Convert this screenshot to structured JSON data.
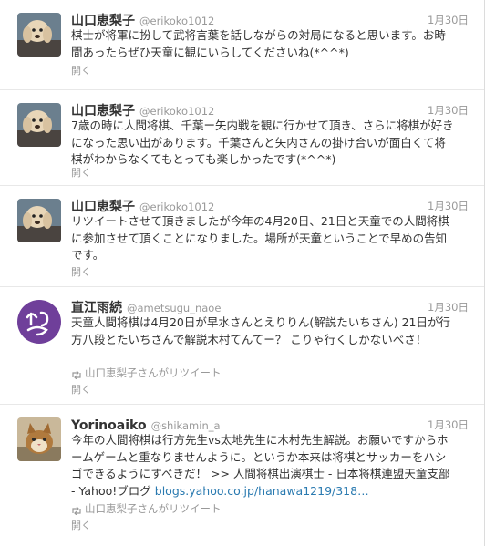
{
  "tweets": [
    {
      "name": "山口恵梨子",
      "handle": "@erikoko1012",
      "time": "1月30日",
      "text": "棋士が将軍に扮して武将言葉を話しながらの対局になると思います。お時間あったらぜひ天童に観にいらしてくださいね(*^^*)",
      "expand": "開く"
    },
    {
      "name": "山口恵梨子",
      "handle": "@erikoko1012",
      "time": "1月30日",
      "text": "7歳の時に人間将棋、千葉ー矢内戦を観に行かせて頂き、さらに将棋が好きになった思い出があります。千葉さんと矢内さんの掛け合いが面白くて将棋がわからなくてもとっても楽しかったです(*^^*)",
      "expand": "開く"
    },
    {
      "name": "山口恵梨子",
      "handle": "@erikoko1012",
      "time": "1月30日",
      "text": "リツイートさせて頂きましたが今年の4月20日、21日と天童での人間将棋に参加させて頂くことになりました。場所が天童ということで早めの告知です。",
      "expand": "開く"
    },
    {
      "name": "直江雨続",
      "handle": "@ametsugu_naoe",
      "time": "1月30日",
      "text": "天童人間将棋は4月20日が早水さんとえりりん(解説たいちさん) 21日が行方八段とたいちさんで解説木村てんてー？ こりゃ行くしかないべさ！",
      "retweet": "山口恵梨子さんがリツイート",
      "expand": "開く"
    },
    {
      "name": "Yorinoaiko",
      "handle": "@shikamin_a",
      "time": "1月30日",
      "text": "今年の人間将棋は行方先生vs太地先生に木村先生解説。お願いですからホームゲームと重なりませんように。というか本来は将棋とサッカーをハシゴできるようにすべきだ！ >> 人間将棋出演棋士 - 日本将棋連盟天童支部 - Yahoo!ブログ ",
      "link": "blogs.yahoo.co.jp/hanawa1219/318…",
      "retweet": "山口恵梨子さんがリツイート",
      "expand": "開く"
    }
  ],
  "icons": {
    "retweet": "retweet-icon",
    "avatar_1": "dog-photo-avatar",
    "avatar_4": "purple-logo-avatar",
    "avatar_5": "cat-photo-avatar"
  },
  "colors": {
    "link": "#2a7ab0",
    "avatar_logo": "#6f3f9a",
    "muted": "#999999"
  }
}
